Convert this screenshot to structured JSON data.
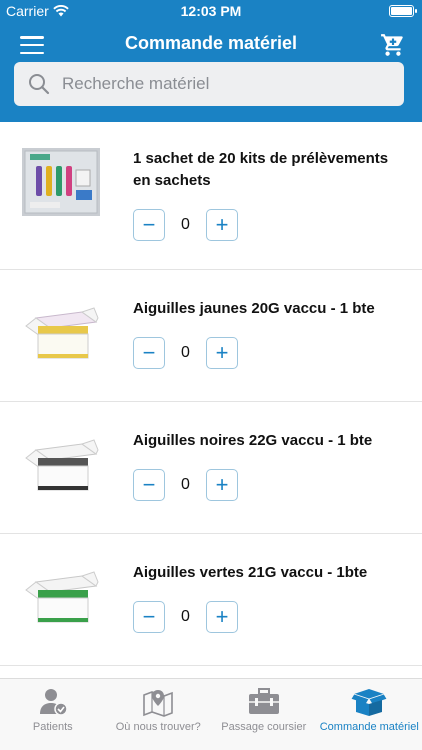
{
  "status_bar": {
    "carrier": "Carrier",
    "time": "12:03 PM"
  },
  "nav": {
    "title": "Commande matériel",
    "menu_icon": "hamburger-menu-icon",
    "cart_icon": "cart-icon"
  },
  "search": {
    "placeholder": "Recherche matériel",
    "value": ""
  },
  "products": [
    {
      "name": "1 sachet de 20 kits de prélèvements en sachets",
      "quantity": 0
    },
    {
      "name": "Aiguilles jaunes 20G vaccu - 1 bte",
      "quantity": 0,
      "accent": "#e8c84a"
    },
    {
      "name": "Aiguilles noires 22G vaccu - 1 bte",
      "quantity": 0,
      "accent": "#333333"
    },
    {
      "name": "Aiguilles vertes 21G vaccu - 1bte",
      "quantity": 0,
      "accent": "#3aa04a"
    }
  ],
  "stepper": {
    "minus": "−",
    "plus": "+"
  },
  "tabs": [
    {
      "label": "Patients",
      "icon": "patients-icon"
    },
    {
      "label": "Où nous trouver?",
      "icon": "map-icon"
    },
    {
      "label": "Passage coursier",
      "icon": "courier-case-icon"
    },
    {
      "label": "Commande matériel",
      "icon": "box-icon",
      "active": true
    }
  ],
  "colors": {
    "primary": "#1a82c4",
    "tab_inactive": "#8e8e93"
  }
}
